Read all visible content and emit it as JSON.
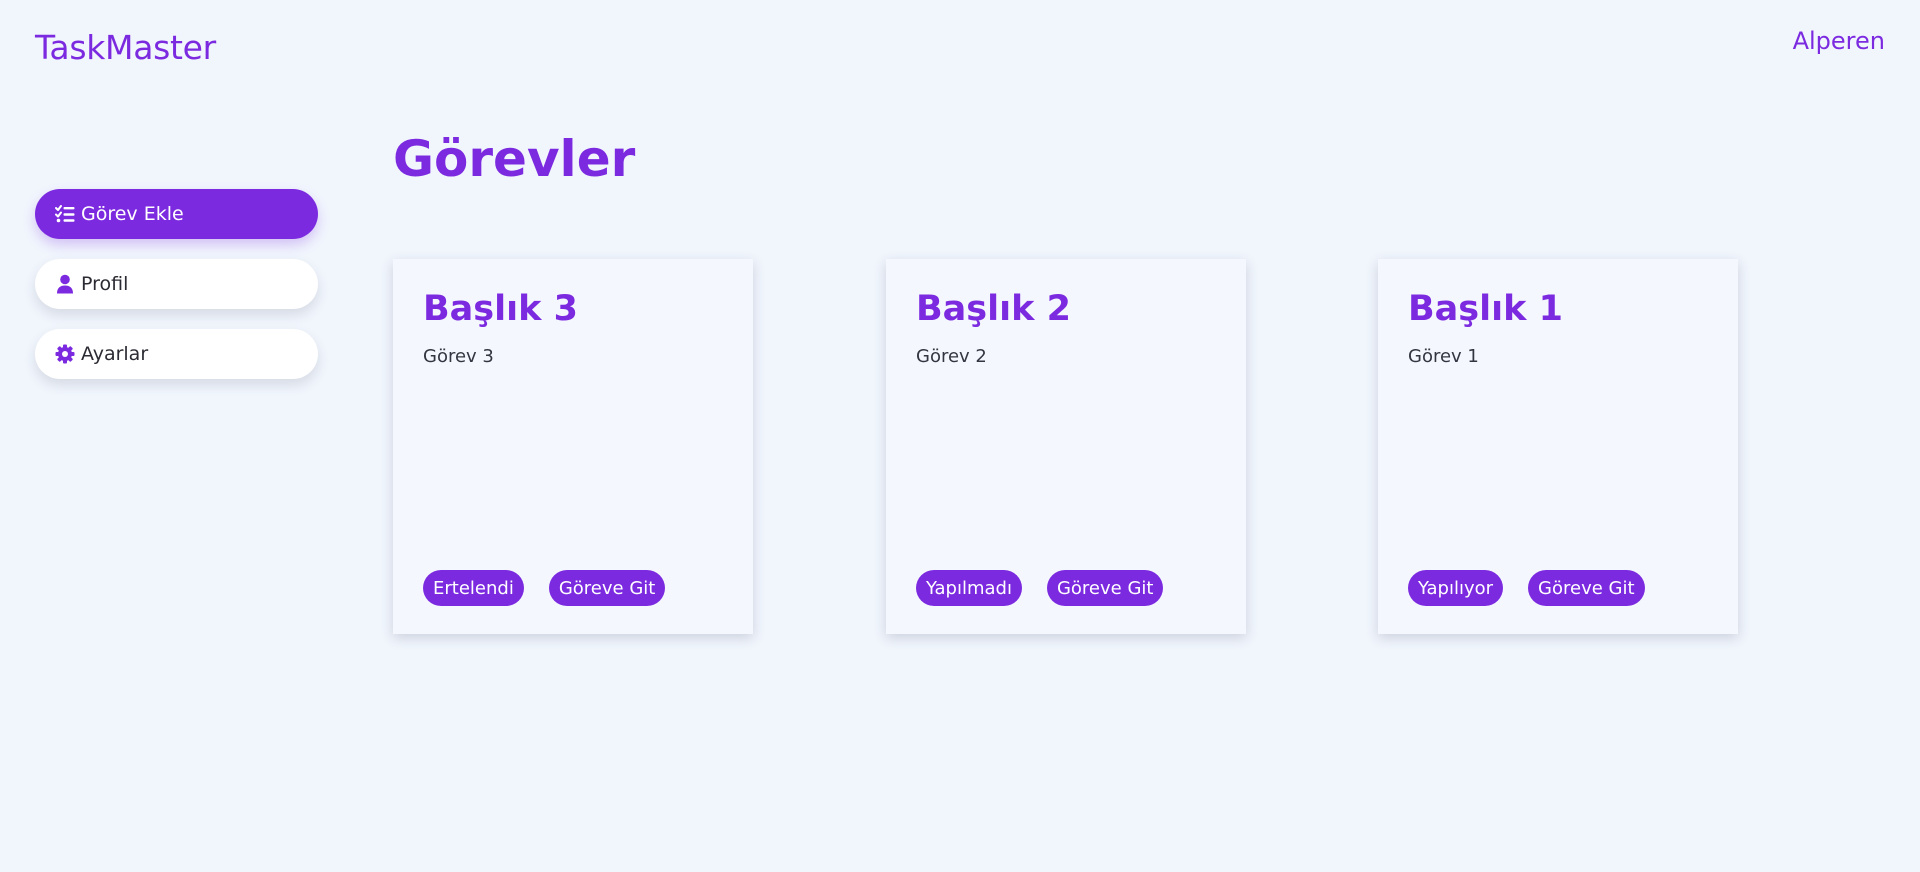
{
  "header": {
    "brand": "TaskMaster",
    "user": "Alperen"
  },
  "sidebar": {
    "items": [
      {
        "label": "Görev Ekle",
        "icon": "list-check-icon",
        "active": true
      },
      {
        "label": "Profil",
        "icon": "user-icon",
        "active": false
      },
      {
        "label": "Ayarlar",
        "icon": "gear-icon",
        "active": false
      }
    ]
  },
  "main": {
    "title": "Görevler",
    "cards": [
      {
        "title": "Başlık 3",
        "description": "Görev 3",
        "status": "Ertelendi",
        "action": "Göreve Git"
      },
      {
        "title": "Başlık 2",
        "description": "Görev 2",
        "status": "Yapılmadı",
        "action": "Göreve Git"
      },
      {
        "title": "Başlık 1",
        "description": "Görev 1",
        "status": "Yapılıyor",
        "action": "Göreve Git"
      }
    ]
  },
  "colors": {
    "accent": "#7c2ae0",
    "background": "#f1f6fd",
    "card": "#f4f7fe"
  }
}
